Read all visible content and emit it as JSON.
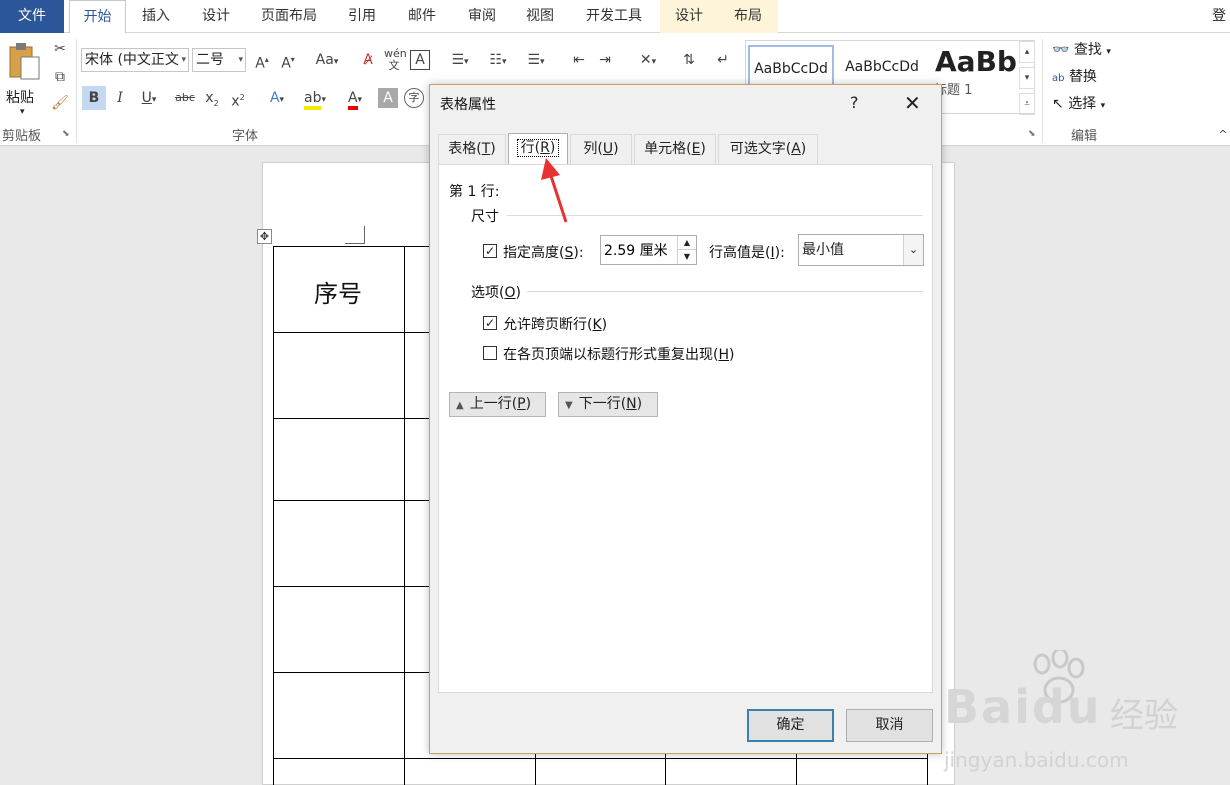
{
  "ribbon": {
    "tabs": [
      {
        "label": "文件"
      },
      {
        "label": "开始"
      },
      {
        "label": "插入"
      },
      {
        "label": "设计"
      },
      {
        "label": "页面布局"
      },
      {
        "label": "引用"
      },
      {
        "label": "邮件"
      },
      {
        "label": "审阅"
      },
      {
        "label": "视图"
      },
      {
        "label": "开发工具"
      },
      {
        "label": "设计"
      },
      {
        "label": "布局"
      }
    ],
    "login": "登",
    "clipboard": {
      "paste_label": "粘贴",
      "group_label": "剪贴板"
    },
    "font": {
      "name": "宋体 (中文正文",
      "size": "二号",
      "group_label": "字体",
      "case_label": "Aa"
    },
    "styles": {
      "items": [
        {
          "preview": "AaBbCcDd",
          "name": ""
        },
        {
          "preview": "AaBbCcDd",
          "name": ""
        },
        {
          "preview": "AaBb",
          "name": "标题 1"
        }
      ]
    },
    "editing": {
      "find": "查找",
      "replace": "替换",
      "select": "选择",
      "group_label": "编辑"
    }
  },
  "document": {
    "header_cell": "序号"
  },
  "dialog": {
    "title": "表格属性",
    "help": "?",
    "close": "✕",
    "tabs": [
      {
        "label": "表格(T)",
        "text": "表格(",
        "key": "T",
        "end": ")"
      },
      {
        "label": "行(R)",
        "text": "行(",
        "key": "R",
        "end": ")"
      },
      {
        "label": "列(U)",
        "text": "列(",
        "key": "U",
        "end": ")"
      },
      {
        "label": "单元格(E)",
        "text": "单元格(",
        "key": "E",
        "end": ")"
      },
      {
        "label": "可选文字(A)",
        "text": "可选文字(",
        "key": "A",
        "end": ")"
      }
    ],
    "row_heading": "第 1 行:",
    "size_section": "尺寸",
    "specify_height": {
      "text": "指定高度(",
      "key": "S",
      "end": "):",
      "checked": true
    },
    "height_value": "2.59 厘米",
    "row_height_is": {
      "text": "行高值是(",
      "key": "I",
      "end": "):"
    },
    "row_height_mode": "最小值",
    "options_section": {
      "text": "选项(",
      "key": "O",
      "end": ")"
    },
    "allow_break": {
      "text": "允许跨页断行(",
      "key": "K",
      "end": ")",
      "checked": true
    },
    "repeat_header": {
      "text": "在各页顶端以标题行形式重复出现(",
      "key": "H",
      "end": ")",
      "checked": false
    },
    "prev_row": {
      "text": "上一行(",
      "key": "P",
      "end": ")"
    },
    "next_row": {
      "text": "下一行(",
      "key": "N",
      "end": ")"
    },
    "ok": "确定",
    "cancel": "取消"
  },
  "watermark": {
    "brand": "Baidu",
    "product": "经验",
    "url": "jingyan.baidu.com"
  }
}
